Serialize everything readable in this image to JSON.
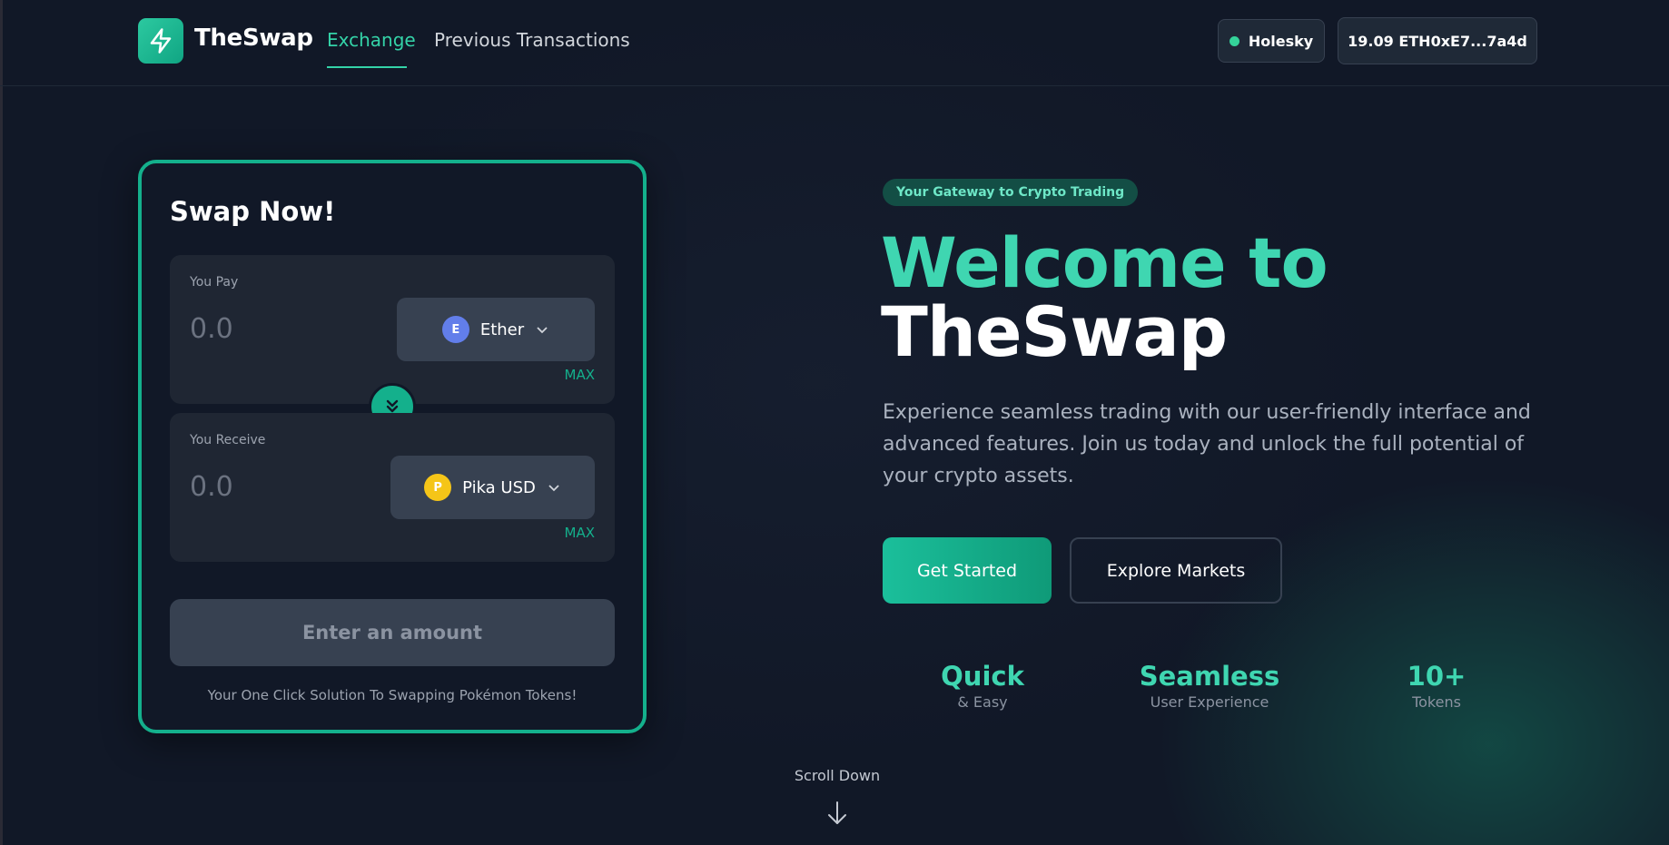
{
  "nav": {
    "brand": "TheSwap",
    "tabs": [
      {
        "label": "Exchange",
        "active": true
      },
      {
        "label": "Previous Transactions",
        "active": false
      }
    ],
    "network": "Holesky",
    "wallet": "19.09 ETH0xE7...7a4d"
  },
  "swap": {
    "title": "Swap Now!",
    "pay": {
      "label": "You Pay",
      "value": "0.0",
      "token": "Ether",
      "token_letter": "E",
      "token_color": "#627eea",
      "max": "MAX"
    },
    "receive": {
      "label": "You Receive",
      "value": "0.0",
      "token": "Pika USD",
      "token_letter": "P",
      "token_color": "#f5c518",
      "max": "MAX"
    },
    "submit": "Enter an amount",
    "footer": "Your One Click Solution To Swapping Pokémon Tokens!"
  },
  "hero": {
    "badge": "Your Gateway to Crypto Trading",
    "title_line1": "Welcome to",
    "title_line2": "TheSwap",
    "description": "Experience seamless trading with our user-friendly interface and advanced features. Join us today and unlock the full potential of your crypto assets.",
    "primary_button": "Get Started",
    "secondary_button": "Explore Markets",
    "stats": [
      {
        "value": "Quick",
        "label": "& Easy"
      },
      {
        "value": "Seamless",
        "label": "User Experience"
      },
      {
        "value": "10+",
        "label": "Tokens"
      }
    ]
  },
  "scroll_hint": "Scroll Down",
  "colors": {
    "accent": "#14b08c",
    "accent_light": "#3fd6b1",
    "background": "#111827"
  }
}
